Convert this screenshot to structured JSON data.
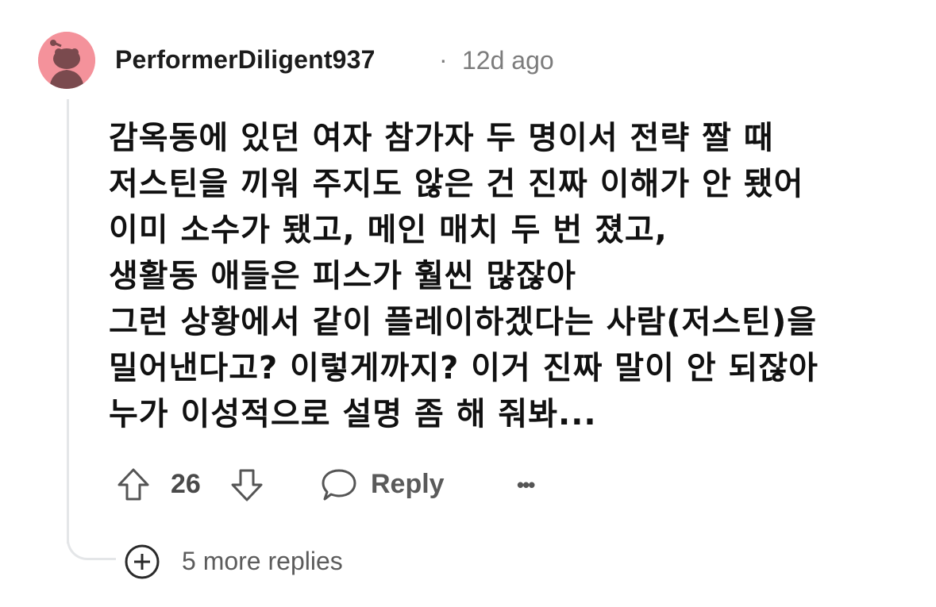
{
  "comment": {
    "username": "PerformerDiligent937",
    "separator": "·",
    "timestamp": "12d ago",
    "body_lines": [
      "감옥동에 있던 여자 참가자 두 명이서 전략 짤 때",
      "저스틴을 끼워 주지도 않은 건 진짜 이해가 안 됐어",
      "이미 소수가 됐고, 메인 매치 두 번 졌고,",
      "생활동 애들은 피스가 훨씬 많잖아",
      "그런 상황에서 같이 플레이하겠다는 사람(저스틴)을",
      "밀어낸다고? 이렇게까지? 이거 진짜 말이 안 되잖아",
      "누가 이성적으로 설명 좀 해 줘봐..."
    ],
    "upvote_count": "26",
    "reply_label": "Reply",
    "more_label": "•••"
  },
  "more_replies": {
    "label": "5 more replies"
  },
  "colors": {
    "avatar_bg": "#f4929b",
    "thread_line": "#e4e6e8",
    "text_primary": "#1c1c1c",
    "text_muted": "#7c7c7c"
  },
  "icons": {
    "avatar": "snoo-avatar-icon",
    "upvote": "arrow-up-icon",
    "downvote": "arrow-down-icon",
    "reply": "speech-bubble-icon",
    "more": "ellipsis-icon",
    "expand": "plus-circle-icon"
  }
}
